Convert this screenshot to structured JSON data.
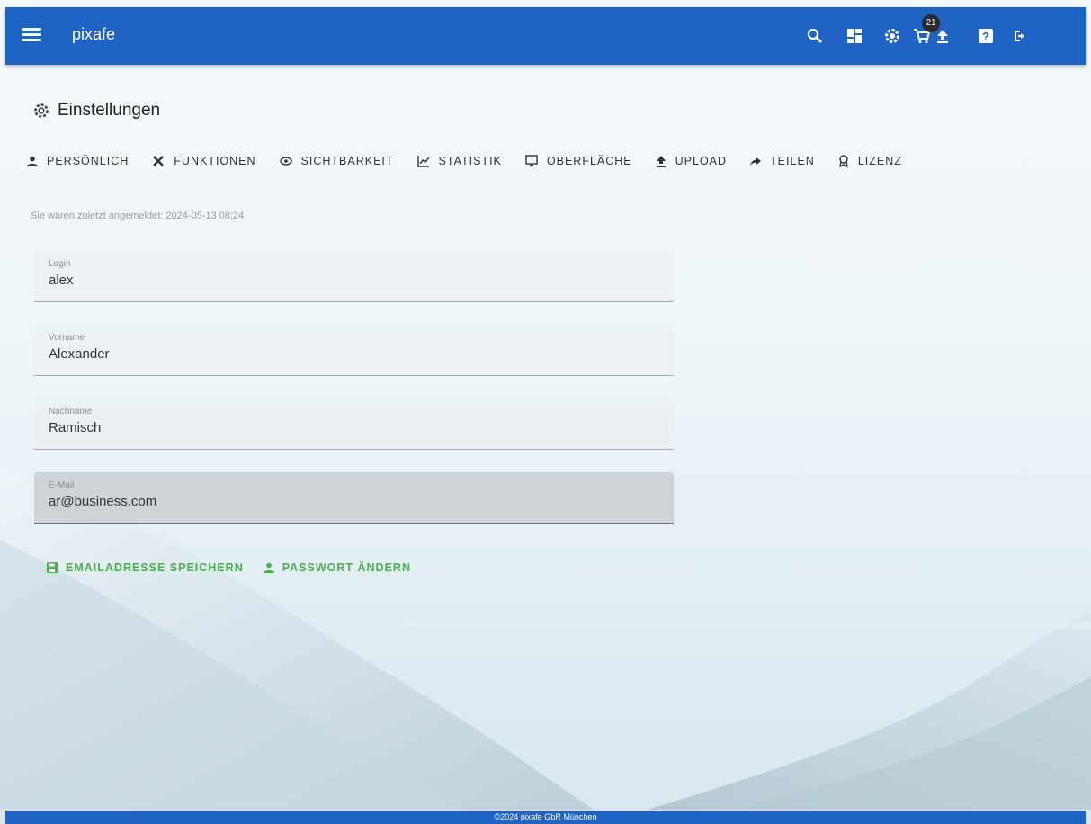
{
  "app": {
    "brand": "pixafe"
  },
  "header": {
    "icons": [
      "search-icon",
      "dashboard-icon",
      "settings-icon",
      "cart-icon",
      "upload-icon",
      "help-icon",
      "logout-icon"
    ],
    "cart_badge": "21"
  },
  "page": {
    "title": "Einstellungen"
  },
  "tabs": [
    {
      "label": "PERSÖNLICH",
      "icon": "person-icon"
    },
    {
      "label": "FUNKTIONEN",
      "icon": "tools-icon"
    },
    {
      "label": "SICHTBARKEIT",
      "icon": "eye-icon"
    },
    {
      "label": "STATISTIK",
      "icon": "chart-icon"
    },
    {
      "label": "OBERFLÄCHE",
      "icon": "monitor-icon"
    },
    {
      "label": "UPLOAD",
      "icon": "upload-icon"
    },
    {
      "label": "TEILEN",
      "icon": "share-icon"
    },
    {
      "label": "LIZENZ",
      "icon": "license-icon"
    }
  ],
  "last_login": "Sie waren zuletzt angemeldet: 2024-05-13 08:24",
  "form": {
    "login": {
      "label": "Login",
      "value": "alex"
    },
    "firstname": {
      "label": "Vorname",
      "value": "Alexander"
    },
    "lastname": {
      "label": "Nachname",
      "value": "Ramisch"
    },
    "email": {
      "label": "E-Mail",
      "value": "ar@business.com"
    }
  },
  "actions": {
    "save_email": "EMAILADRESSE SPEICHERN",
    "change_password": "PASSWORT ÄNDERN"
  },
  "footer": {
    "text": "©2024 pixafe GbR München"
  },
  "colors": {
    "primary": "#1f63c4",
    "accent": "#4caf50"
  }
}
